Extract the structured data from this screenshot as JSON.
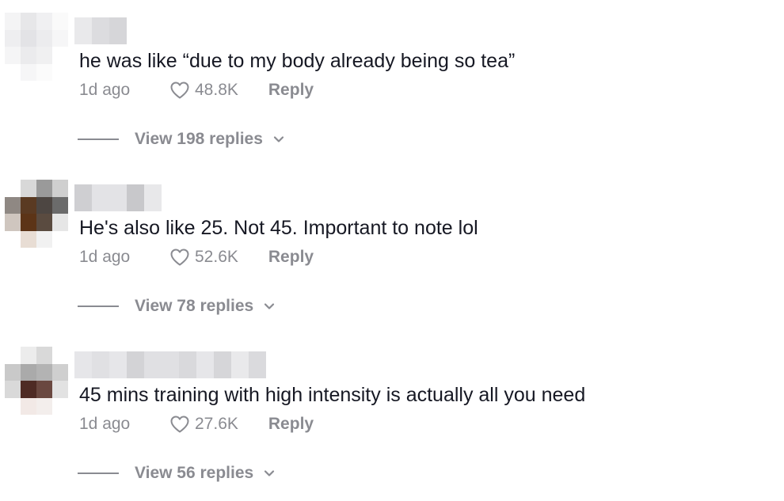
{
  "comments": [
    {
      "avatar_pixels": [
        "#f4f4f5",
        "#e7e7e9",
        "#f0f0f2",
        "#fafafa",
        "#eeeef0",
        "#e3e3e6",
        "#ececee",
        "#f6f6f7",
        "#f5f5f6",
        "#ebebed",
        "#f0f0f1",
        "#ffffff",
        "#ffffff",
        "#f6f6f7",
        "#fbfbfb",
        "#ffffff"
      ],
      "username_pixels": [
        "#e9e9eb",
        "#dcdcdf",
        "#d6d6d9"
      ],
      "text": "he was like “due to my body already being so tea”",
      "time": "1d ago",
      "likes": "48.8K",
      "reply_label": "Reply",
      "view_replies": "View 198 replies"
    },
    {
      "avatar_pixels": [
        "#ffffff",
        "#d8d8d8",
        "#9a9a9a",
        "#cfcfcf",
        "#8f8883",
        "#5a3a22",
        "#4d4642",
        "#6b6b6b",
        "#cfc6bf",
        "#5c3417",
        "#5a4b40",
        "#e6e6e6",
        "#ffffff",
        "#e8ddd4",
        "#f1f1f1",
        "#ffffff"
      ],
      "username_pixels": [
        "#cfcfd2",
        "#e3e3e6",
        "#e3e3e6",
        "#c8c8cb",
        "#e8e8ea"
      ],
      "text": "He's also like 25. Not 45. Important to note lol",
      "time": "1d ago",
      "likes": "52.6K",
      "reply_label": "Reply",
      "view_replies": "View 78 replies"
    },
    {
      "avatar_pixels": [
        "#ffffff",
        "#ececec",
        "#d9d9d9",
        "#ffffff",
        "#c9c9c9",
        "#aaaaaa",
        "#b3b3b3",
        "#cfcfcf",
        "#d9d9d9",
        "#4e2b24",
        "#6a4840",
        "#e2e2e2",
        "#ffffff",
        "#f2e9e6",
        "#f3eeec",
        "#ffffff"
      ],
      "username_pixels": [
        "#e6e6e9",
        "#e0e0e3",
        "#e6e6e9",
        "#d3d3d6",
        "#e0e0e3",
        "#e0e0e3",
        "#d9d9dc",
        "#e6e6e9",
        "#d6d6d9",
        "#e9e9eb",
        "#dadadd"
      ],
      "text": "45 mins training with high intensity is actually all you need",
      "time": "1d ago",
      "likes": "27.6K",
      "reply_label": "Reply",
      "view_replies": "View 56 replies"
    }
  ],
  "colors": {
    "text_primary": "#161823",
    "text_secondary": "#8a8b91",
    "background": "#ffffff"
  },
  "icons": {
    "like": "heart-outline-icon",
    "expand": "chevron-down-icon"
  }
}
